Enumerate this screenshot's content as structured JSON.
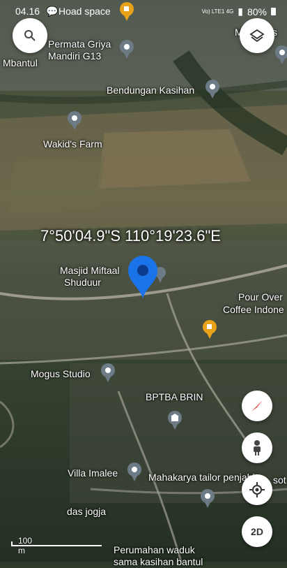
{
  "status_bar": {
    "time": "04.16",
    "notif_label": "Hoad space",
    "network": "Vo) LTE1 4G",
    "battery": "80%"
  },
  "map": {
    "coordinates": "7°50'04.9\"S 110°19'23.6\"E",
    "places": [
      {
        "name": "Permata Griya\nMandiri G13",
        "icon": "location-pin-icon"
      },
      {
        "name": "Mbantul",
        "icon": "none"
      },
      {
        "name": "Bendungan Kasihan",
        "icon": "location-pin-icon"
      },
      {
        "name": "Wakid's Farm",
        "icon": "location-pin-icon"
      },
      {
        "name": "Masjid Miftaal\nShuduur",
        "icon": "mosque-pin-icon"
      },
      {
        "name": "Pour Over\nCoffee Indone",
        "icon": "coffee-pin-icon"
      },
      {
        "name": "Mogus Studio",
        "icon": "location-pin-icon"
      },
      {
        "name": "BPTBA BRIN",
        "icon": "government-building-icon"
      },
      {
        "name": "Villa Imalee",
        "icon": "location-pin-icon"
      },
      {
        "name": "Mahakarya tailor penjahi",
        "icon": "location-pin-icon"
      },
      {
        "name": "das jogja",
        "icon": "none"
      },
      {
        "name": "Perumahan waduk\nsama kasihan bantul",
        "icon": "none"
      },
      {
        "name": "M",
        "icon": "none"
      },
      {
        "name": "sot",
        "icon": "none"
      }
    ]
  },
  "controls": {
    "search_icon": "search-icon",
    "layers_icon": "layers-icon",
    "compass_icon": "compass-icon",
    "street_view_icon": "street-view-icon",
    "my_location_icon": "my-location-icon",
    "view_mode": "2D"
  },
  "scale": {
    "label": "100 m"
  },
  "colors": {
    "pin_blue": "#1a73e8",
    "pin_gray": "#6d7b86",
    "coffee": "#e8a21a"
  }
}
